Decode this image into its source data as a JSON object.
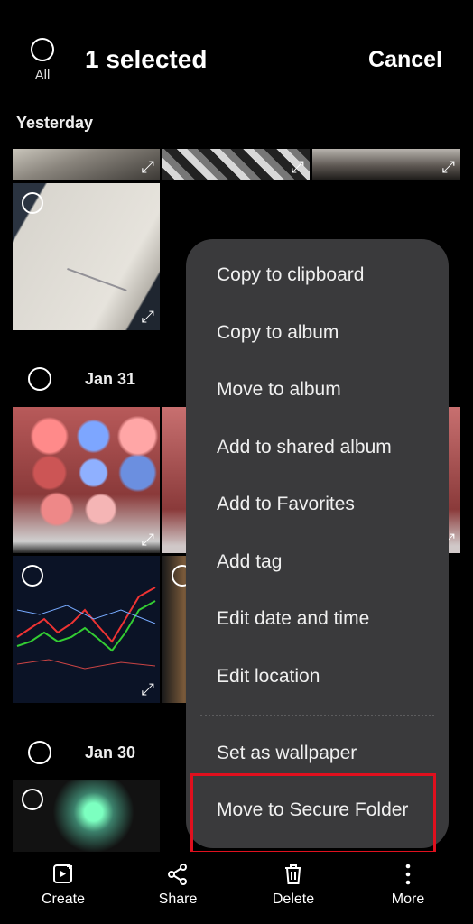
{
  "header": {
    "select_all_label": "All",
    "title": "1 selected",
    "cancel_label": "Cancel"
  },
  "sections": [
    {
      "label": "Yesterday"
    },
    {
      "label": "Jan 31"
    },
    {
      "label": "Jan 30"
    }
  ],
  "menu": {
    "items": [
      "Copy to clipboard",
      "Copy to album",
      "Move to album",
      "Add to shared album",
      "Add to Favorites",
      "Add tag",
      "Edit date and time",
      "Edit location",
      "Set as wallpaper",
      "Move to Secure Folder"
    ],
    "highlighted_item": "Move to Secure Folder",
    "highlight_color": "#e0101e"
  },
  "bottom_bar": {
    "items": [
      {
        "label": "Create",
        "icon": "create-icon"
      },
      {
        "label": "Share",
        "icon": "share-icon"
      },
      {
        "label": "Delete",
        "icon": "trash-icon"
      },
      {
        "label": "More",
        "icon": "more-vertical-icon"
      }
    ]
  }
}
